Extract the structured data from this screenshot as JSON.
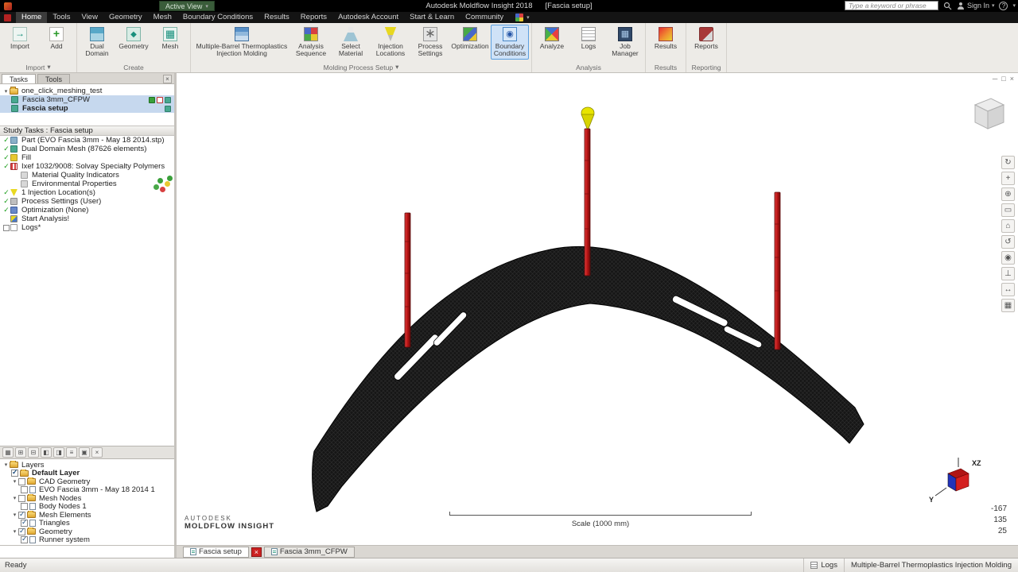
{
  "titlebar": {
    "active_view": "Active View",
    "title": "Autodesk Moldflow Insight 2018",
    "document": "[Fascia setup]",
    "search_placeholder": "Type a keyword or phrase",
    "sign_in": "Sign In"
  },
  "menubar": {
    "items": [
      "Home",
      "Tools",
      "View",
      "Geometry",
      "Mesh",
      "Boundary Conditions",
      "Results",
      "Reports",
      "Autodesk Account",
      "Start & Learn",
      "Community"
    ]
  },
  "ribbon": {
    "groups": [
      {
        "label": "Import",
        "arrow": "▾",
        "buttons": [
          {
            "label": "Import"
          },
          {
            "label": "Add"
          }
        ]
      },
      {
        "label": "Create",
        "arrow": "",
        "buttons": [
          {
            "label": "Dual Domain"
          },
          {
            "label": "Geometry"
          },
          {
            "label": "Mesh"
          }
        ]
      },
      {
        "label": "Molding Process Setup",
        "arrow": "▾",
        "buttons": [
          {
            "label": "Multiple-Barrel Thermoplastics Injection Molding"
          },
          {
            "label": "Analysis Sequence"
          },
          {
            "label": "Select Material"
          },
          {
            "label": "Injection Locations"
          },
          {
            "label": "Process Settings"
          },
          {
            "label": "Optimization"
          },
          {
            "label": "Boundary Conditions"
          }
        ]
      },
      {
        "label": "Analysis",
        "arrow": "",
        "buttons": [
          {
            "label": "Analyze"
          },
          {
            "label": "Logs"
          },
          {
            "label": "Job Manager"
          }
        ]
      },
      {
        "label": "Results",
        "arrow": "",
        "buttons": [
          {
            "label": "Results"
          }
        ]
      },
      {
        "label": "Reporting",
        "arrow": "",
        "buttons": [
          {
            "label": "Reports"
          }
        ]
      }
    ]
  },
  "tasks_panel": {
    "tab_tasks": "Tasks",
    "tab_tools": "Tools",
    "tree": {
      "project": "one_click_meshing_test",
      "study1": "Fascia 3mm_CFPW",
      "study2": "Fascia setup"
    },
    "study_header": "Study Tasks : Fascia setup",
    "items": [
      "Part (EVO Fascia 3mm - May 18 2014.stp)",
      "Dual Domain Mesh (87626 elements)",
      "Fill",
      "Ixef 1032/9008: Solvay Specialty Polymers",
      "Material Quality Indicators",
      "Environmental Properties",
      "1 Injection Location(s)",
      "Process Settings (User)",
      "Optimization (None)",
      "Start Analysis!",
      "Logs*"
    ]
  },
  "layers_toolbar": [
    "▦",
    "⊞",
    "⊟",
    "◧",
    "◨",
    "≡",
    "▣",
    "×"
  ],
  "layers_panel": {
    "root": "Layers",
    "items": [
      "Default Layer",
      "CAD Geometry",
      "EVO Fascia 3mm - May 18 2014 1",
      "Mesh Nodes",
      "Body Nodes 1",
      "Mesh Elements",
      "Triangles",
      "Geometry",
      "Runner system"
    ]
  },
  "viewport": {
    "logo1": "AUTODESK",
    "logo2": "MOLDFLOW INSIGHT",
    "scale_label": "Scale (1000 mm)",
    "coords": [
      "-167",
      "135",
      "25"
    ],
    "axis_xz": "XZ",
    "axis_y": "Y",
    "tools": [
      "↻",
      "+",
      "⊕",
      "▭",
      "⌂",
      "↺",
      "◉",
      "⊥",
      "↔",
      "▦"
    ]
  },
  "doc_tabs": {
    "tab1": "Fascia setup",
    "tab2": "Fascia 3mm_CFPW"
  },
  "statusbar": {
    "ready": "Ready",
    "logs": "Logs",
    "mode": "Multiple-Barrel Thermoplastics Injection Molding"
  },
  "icons": {
    "dropdown": "▾",
    "close": "×",
    "expander": "▾",
    "check": "✓",
    "minimize": "─",
    "restore": "□",
    "help": "?"
  }
}
